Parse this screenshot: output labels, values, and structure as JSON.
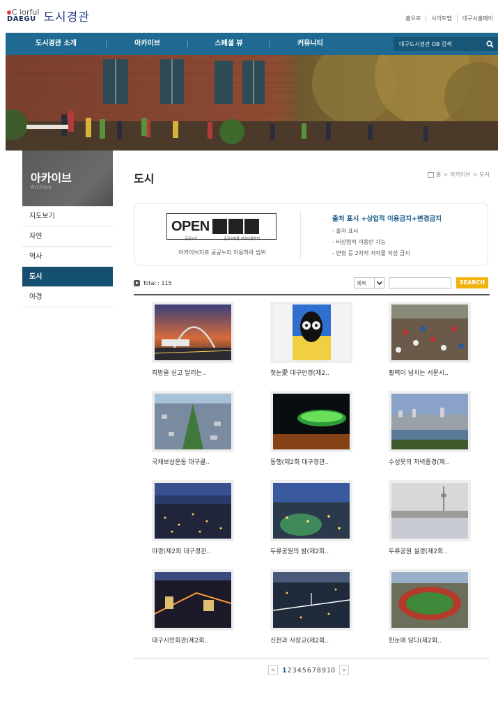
{
  "header": {
    "logo_en_1": "C  lorful",
    "logo_en_2": "DAEGU",
    "logo_kr": "도시경관",
    "util_links": [
      "홈으로",
      "사이트맵",
      "대구시홈페이"
    ]
  },
  "nav": {
    "items": [
      "도시경관 소개",
      "아카이브",
      "스페셜 뷰",
      "커뮤니티"
    ],
    "search_placeholder": "대구도시경관 DB 검색"
  },
  "sidebar": {
    "title": "아카이브",
    "subtitle": "Archive",
    "items": [
      {
        "label": "지도보기",
        "active": false
      },
      {
        "label": "자연",
        "active": false
      },
      {
        "label": "역사",
        "active": false
      },
      {
        "label": "도시",
        "active": true
      },
      {
        "label": "야경",
        "active": false
      }
    ]
  },
  "page": {
    "title": "도시",
    "breadcrumb": [
      "홈",
      ">",
      "아카이브",
      ">",
      "도시"
    ]
  },
  "license": {
    "open_text": "OPEN",
    "badge_sub1": "공공누리",
    "badge_sub2": "공공저작물 자유이용허락",
    "caption": "아카이브자료 공공누리 이용허락 범위",
    "title": "출처 표시 +상업적 이용금지+변경금지",
    "lines": [
      "- 출처 표시",
      "- 비상업적 이용만 가능",
      "- 변형 등 2차적 저작물 작성 금지"
    ]
  },
  "list": {
    "total_label": "Total : 115",
    "filter_option": "제목",
    "search_button": "SEARCH",
    "items": [
      {
        "caption": "희망을 싣고 달리는..",
        "thumb": "bridge-train"
      },
      {
        "caption": "첫눈愛 대구안경(제2..",
        "thumb": "glasses-sculpture"
      },
      {
        "caption": "활력이 넘치는 서문시..",
        "thumb": "market-crowd"
      },
      {
        "caption": "국채보상운동 대구클..",
        "thumb": "city-aerial-park"
      },
      {
        "caption": "동행(제2회 대구경관..",
        "thumb": "ufo-stadium-night"
      },
      {
        "caption": "수성못의 저녁풍경(제..",
        "thumb": "lake-city-dusk"
      },
      {
        "caption": "야경(제2회 대구경관..",
        "thumb": "city-night-lights"
      },
      {
        "caption": "두류공원의 밤(제2회..",
        "thumb": "park-night"
      },
      {
        "caption": "두류공원 설경(제2회..",
        "thumb": "snow-tower"
      },
      {
        "caption": "대구시민회관(제2회..",
        "thumb": "city-hall-night"
      },
      {
        "caption": "신천과 사장교(제2회..",
        "thumb": "river-bridge-night"
      },
      {
        "caption": "한눈에 담다(제2회..",
        "thumb": "stadium-aerial"
      }
    ]
  },
  "pagination": {
    "prev": "<",
    "next": ">",
    "pages": [
      "1",
      "2",
      "3",
      "4",
      "5",
      "6",
      "7",
      "8",
      "9",
      "10"
    ],
    "current": "1"
  },
  "colors": {
    "nav_bg": "#1f6a92",
    "active_menu": "#165070",
    "search_button": "#f2b20c",
    "license_title": "#1c5b8a"
  }
}
